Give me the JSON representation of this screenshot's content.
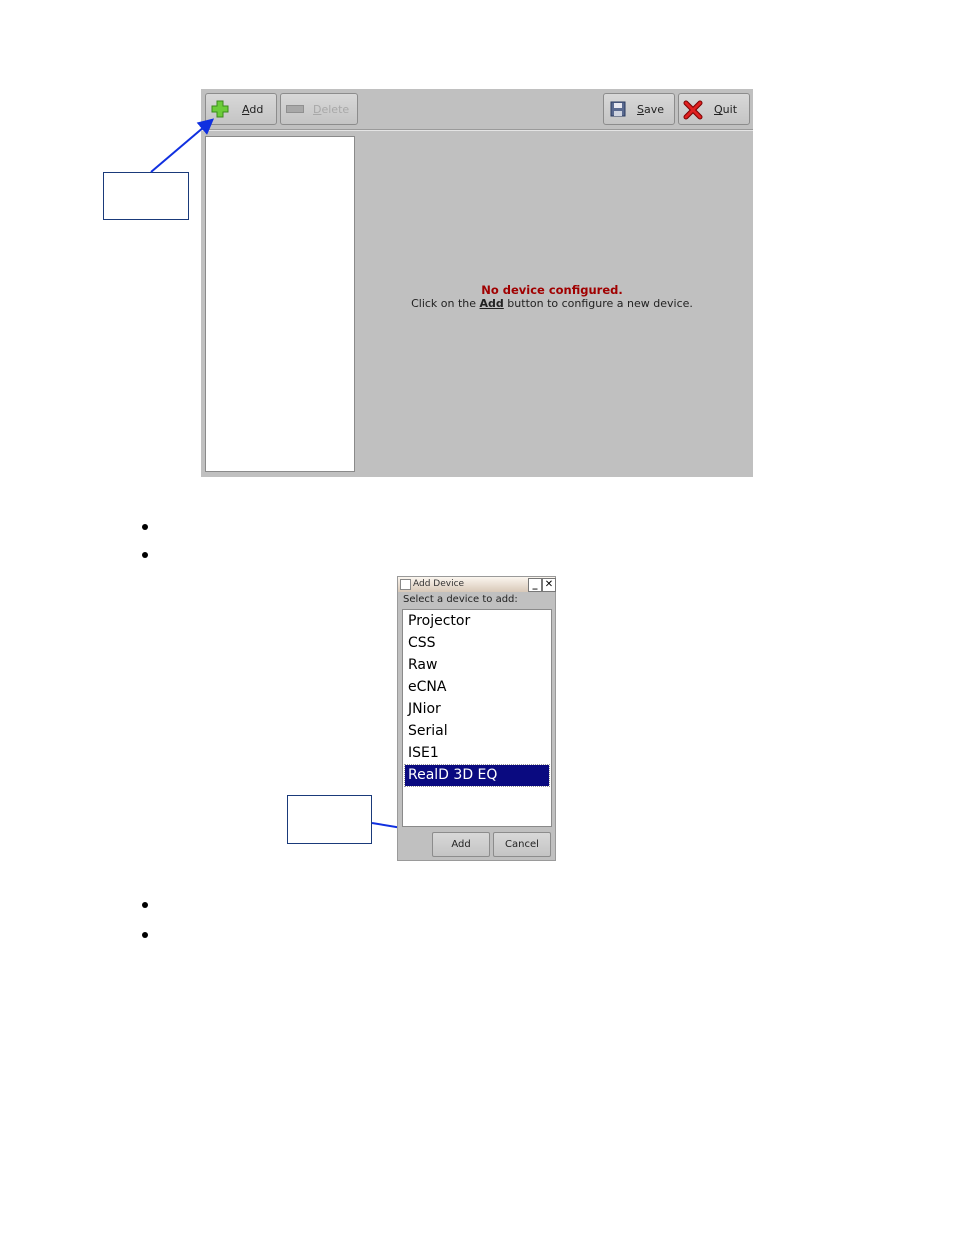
{
  "main_window": {
    "toolbar": {
      "add_label": "Add",
      "delete_label": "Delete",
      "save_label": "Save",
      "quit_label": "Quit"
    },
    "message": {
      "title": "No device configured.",
      "body_prefix": "Click on the ",
      "body_bold": "Add",
      "body_suffix": " button to configure a new device."
    }
  },
  "dialog": {
    "title": "Add Device",
    "minimize_glyph": "_",
    "close_glyph": "✕",
    "prompt": "Select a device to add:",
    "devices": [
      "Projector",
      "CSS",
      "Raw",
      "eCNA",
      "JNior",
      "Serial",
      "ISE1",
      "RealD 3D EQ"
    ],
    "selected_device": "RealD 3D EQ",
    "add_label": "Add",
    "cancel_label": "Cancel"
  },
  "colors": {
    "window_bg": "#c0c0c0",
    "message_title": "#a00000",
    "selection_bg": "#0a0a80",
    "arrow": "#1030e0"
  },
  "icons": [
    "plus-icon",
    "minus-icon",
    "floppy-disk-icon",
    "red-x-icon"
  ]
}
